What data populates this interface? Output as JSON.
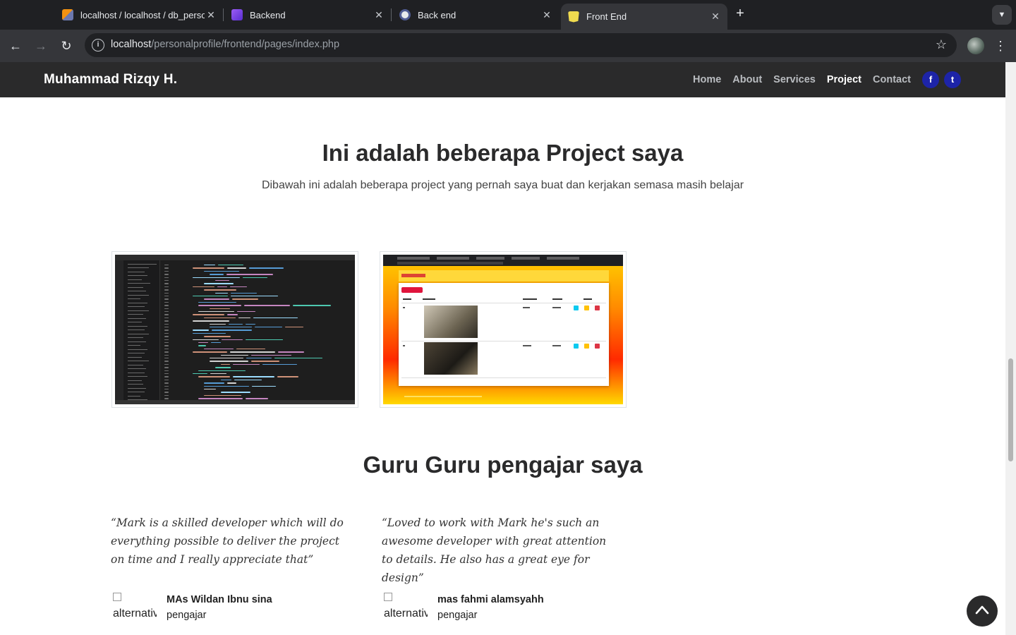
{
  "browser": {
    "tabs": [
      {
        "title": "localhost / localhost / db_personalprofile",
        "icon": "phpmyadmin-icon",
        "active": false
      },
      {
        "title": "Backend",
        "icon": "bootstrap-icon",
        "active": false
      },
      {
        "title": "Back end",
        "icon": "php-icon",
        "active": false
      },
      {
        "title": "Front End",
        "icon": "html5-icon",
        "active": true
      }
    ],
    "url_host": "localhost",
    "url_path": "/personalprofile/frontend/pages/index.php"
  },
  "site": {
    "brand": "Muhammad Rizqy H.",
    "nav": [
      {
        "label": "Home",
        "active": false
      },
      {
        "label": "About",
        "active": false
      },
      {
        "label": "Services",
        "active": false
      },
      {
        "label": "Project",
        "active": true
      },
      {
        "label": "Contact",
        "active": false
      }
    ],
    "social": [
      {
        "icon": "facebook-icon",
        "glyph": "f"
      },
      {
        "icon": "twitter-icon",
        "glyph": "t"
      }
    ]
  },
  "projects": {
    "title": "Ini adalah beberapa Project saya",
    "subtitle": "Dibawah ini adalah beberapa project yang pernah saya buat dan kerjakan semasa masih belajar",
    "items": [
      {
        "image": "code-editor-screenshot"
      },
      {
        "image": "php-crud-app-screenshot"
      }
    ]
  },
  "teachers": {
    "title": "Guru Guru pengajar saya",
    "testimonials": [
      {
        "quote": "“Mark is a skilled developer which will do everything possible to deliver the project on time and I really appreciate that”",
        "avatar_alt": "alternative",
        "name": "MAs Wildan Ibnu sina",
        "role": "pengajar"
      },
      {
        "quote": "“Loved to work with Mark he's such an awesome developer with great attention to details. He also has a great eye for design”",
        "avatar_alt": "alternative",
        "name": "mas fahmi alamsyahh",
        "role": "pengajar"
      }
    ]
  },
  "colors": {
    "header_bg": "#2a2a2b",
    "social_bg": "#1d24a8",
    "chrome_bg": "#35363a"
  }
}
